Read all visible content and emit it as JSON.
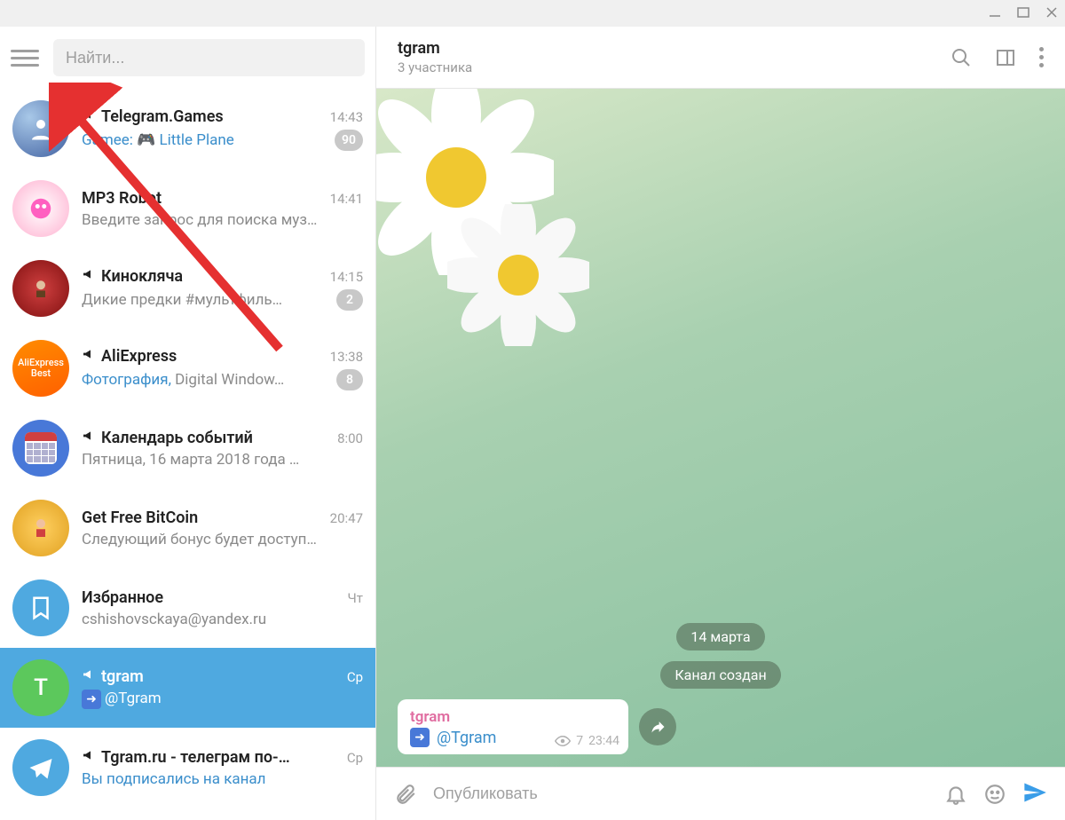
{
  "window": {
    "search_placeholder": "Найти..."
  },
  "chats": [
    {
      "title": "Telegram.Games",
      "time": "14:43",
      "channel": true,
      "sub_prefix": "Gamee: ",
      "sub_accent_prefix": true,
      "sub_rest": "🎮 Little Plane",
      "sub_rest_accent": true,
      "badge": "90"
    },
    {
      "title": "MP3 Robot",
      "time": "14:41",
      "channel": false,
      "sub": "Введите запрос для поиска муз…"
    },
    {
      "title": "Кинокляча",
      "time": "14:15",
      "channel": true,
      "sub": "Дикие предки  #мультфиль…",
      "badge": "2"
    },
    {
      "title": "AliExpress",
      "time": "13:38",
      "channel": true,
      "sub_prefix": "Фотография, ",
      "sub_accent_prefix": true,
      "sub_rest": "Digital Window…",
      "badge": "8"
    },
    {
      "title": "Календарь событий",
      "time": "8:00",
      "channel": true,
      "sub": "Пятница, 16 марта 2018 года  …"
    },
    {
      "title": "Get Free BitCoin",
      "time": "20:47",
      "channel": false,
      "sub": "Следующий бонус будет доступ…"
    },
    {
      "title": "Избранное",
      "time": "Чт",
      "channel": false,
      "sub": "cshishovsckaya@yandex.ru"
    },
    {
      "title": "tgram",
      "time": "Ср",
      "channel": true,
      "sub_arrow": true,
      "sub_rest": "@Tgram",
      "active": true
    },
    {
      "title": "Tgram.ru - телеграм по-…",
      "time": "Ср",
      "channel": true,
      "sub_accent_prefix": true,
      "sub_prefix": "Вы подписались на канал"
    }
  ],
  "header": {
    "title": "tgram",
    "subtitle": "3 участника"
  },
  "conversation": {
    "date_pill": "14 марта",
    "service_pill": "Канал создан",
    "message": {
      "author": "tgram",
      "text": "@Tgram",
      "views": "7",
      "time": "23:44"
    }
  },
  "composer": {
    "placeholder": "Опубликовать"
  },
  "avatar_letters": {
    "tgram": "T"
  },
  "aliexpress_text": "AliExpress\nBest"
}
